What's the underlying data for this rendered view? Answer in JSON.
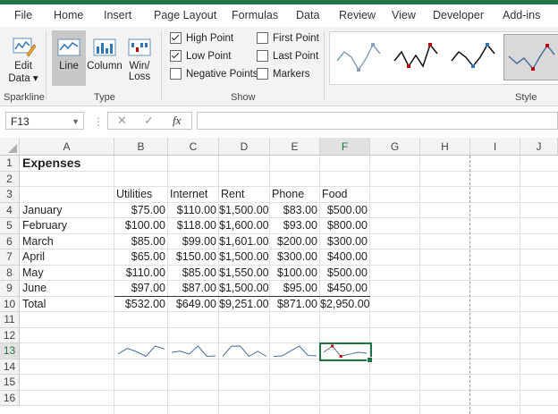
{
  "tabs": [
    "File",
    "Home",
    "Insert",
    "Page Layout",
    "Formulas",
    "Data",
    "Review",
    "View",
    "Developer",
    "Add-ins"
  ],
  "ribbon": {
    "edit_data": "Edit Data",
    "edit_data_l1": "Edit",
    "edit_data_l2": "Data ▾",
    "sparkline_group": "Sparkline",
    "type_group": "Type",
    "line": "Line",
    "column": "Column",
    "winloss_l1": "Win/",
    "winloss_l2": "Loss",
    "show_group": "Show",
    "high_point": "High Point",
    "low_point": "Low Point",
    "negative_points": "Negative Points",
    "first_point": "First Point",
    "last_point": "Last Point",
    "markers": "Markers",
    "style_group": "Style",
    "checks": {
      "high_point": true,
      "low_point": true,
      "negative_points": false,
      "first_point": false,
      "last_point": false,
      "markers": false
    },
    "style_color_line": "#8aa0b4",
    "style_color_red": "#c00000",
    "style_color_blue": "#2e75b6"
  },
  "formula_bar": {
    "name_box": "F13",
    "cancel": "✕",
    "enter": "✓",
    "fx": "fx",
    "formula": ""
  },
  "columns": [
    "A",
    "B",
    "C",
    "D",
    "E",
    "F",
    "G",
    "H",
    "I",
    "J"
  ],
  "selected_column": "F",
  "selected_row": "13",
  "rows": [
    "1",
    "2",
    "3",
    "4",
    "5",
    "6",
    "7",
    "8",
    "9",
    "10",
    "11",
    "12",
    "13",
    "14",
    "15",
    "16"
  ],
  "sheet": {
    "title": "Expenses",
    "headers": [
      "Utilities",
      "Internet",
      "Rent",
      "Phone",
      "Food"
    ],
    "data": [
      {
        "label": "January",
        "values": [
          "$75.00",
          "$110.00",
          "$1,500.00",
          "$83.00",
          "$500.00"
        ]
      },
      {
        "label": "February",
        "values": [
          "$100.00",
          "$118.00",
          "$1,600.00",
          "$93.00",
          "$800.00"
        ]
      },
      {
        "label": "March",
        "values": [
          "$85.00",
          "$99.00",
          "$1,601.00",
          "$200.00",
          "$300.00"
        ]
      },
      {
        "label": "April",
        "values": [
          "$65.00",
          "$150.00",
          "$1,500.00",
          "$300.00",
          "$400.00"
        ]
      },
      {
        "label": "May",
        "values": [
          "$110.00",
          "$85.00",
          "$1,550.00",
          "$100.00",
          "$500.00"
        ]
      },
      {
        "label": "June",
        "values": [
          "$97.00",
          "$87.00",
          "$1,500.00",
          "$95.00",
          "$450.00"
        ]
      }
    ],
    "total_label": "Total",
    "totals": [
      "$532.00",
      "$649.00",
      "$9,251.00",
      "$871.00",
      "$2,950.00"
    ]
  },
  "sparkline_data": [
    [
      75,
      100,
      85,
      65,
      110,
      97
    ],
    [
      110,
      118,
      99,
      150,
      85,
      87
    ],
    [
      1500,
      1600,
      1601,
      1500,
      1550,
      1500
    ],
    [
      83,
      93,
      200,
      300,
      100,
      95
    ],
    [
      500,
      800,
      300,
      400,
      500,
      450
    ]
  ],
  "colors": {
    "excel_green": "#217346",
    "sparkline": "#4a6f9c",
    "high": "#c00000",
    "low": "#c00000"
  }
}
